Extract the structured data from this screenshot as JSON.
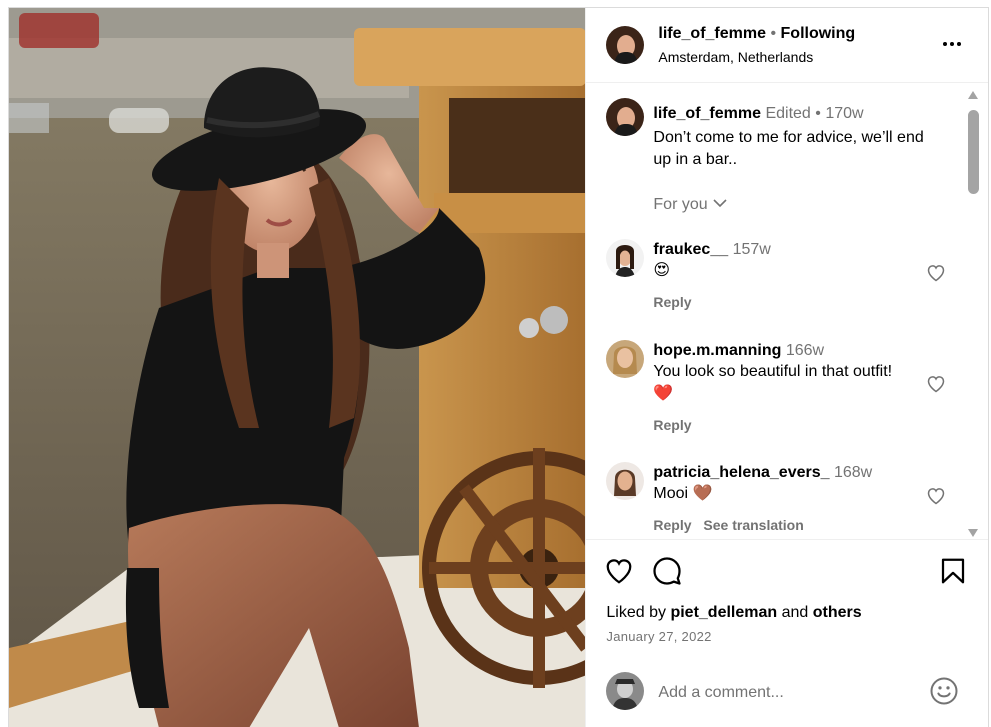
{
  "post": {
    "author": "life_of_femme",
    "follow_status": "Following",
    "location": "Amsterdam, Netherlands"
  },
  "caption": {
    "author": "life_of_femme",
    "edited": "Edited",
    "age": "170w",
    "text_line1": "Don’t come to me for advice, we’ll end",
    "text_line2": "up in a bar..",
    "translation_toggle": "For you"
  },
  "comments": [
    {
      "user": "fraukec__",
      "age": "157w",
      "text": "😍",
      "reply": "Reply"
    },
    {
      "user": "hope.m.manning",
      "age": "166w",
      "text": "You look so beautiful in that outfit!",
      "text2": "❤️",
      "reply": "Reply"
    },
    {
      "user": "patricia_helena_evers_",
      "age": "168w",
      "text": "Mooi 🤎",
      "reply": "Reply",
      "see_translation": "See translation"
    }
  ],
  "likes": {
    "prefix": "Liked by",
    "user": "piet_delleman",
    "and": "and",
    "others": "others"
  },
  "date": "January 27, 2022",
  "add_comment": {
    "placeholder": "Add a comment..."
  },
  "icons": {
    "more": "more-options-icon",
    "like": "heart-icon",
    "comment": "comment-icon",
    "save": "bookmark-icon",
    "emoji": "emoji-icon"
  },
  "colors": {
    "muted": "#737373",
    "like_heart": "#ff3040",
    "border": "#dbdbdb"
  }
}
